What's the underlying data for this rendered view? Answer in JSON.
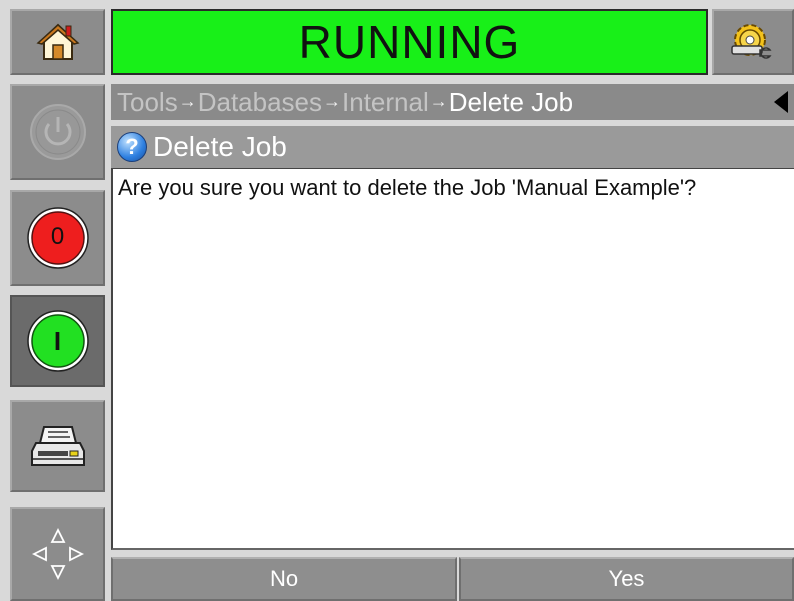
{
  "status": {
    "text": "RUNNING",
    "color": "#18f018"
  },
  "breadcrumb": {
    "items": [
      "Tools",
      "Databases",
      "Internal"
    ],
    "separator": "→",
    "current": "Delete Job"
  },
  "dialog": {
    "title": "Delete Job",
    "question": "Are you sure you want to delete the Job 'Manual Example'?"
  },
  "left_panel": {
    "stop_button_label": "0",
    "start_button_label": "I"
  },
  "footer": {
    "no_label": "No",
    "yes_label": "Yes"
  },
  "icons": [
    "home-icon",
    "settings-icon",
    "power-icon",
    "stop-icon",
    "start-icon",
    "printer-icon",
    "navigation-icon",
    "help-icon",
    "back-arrow-icon"
  ]
}
